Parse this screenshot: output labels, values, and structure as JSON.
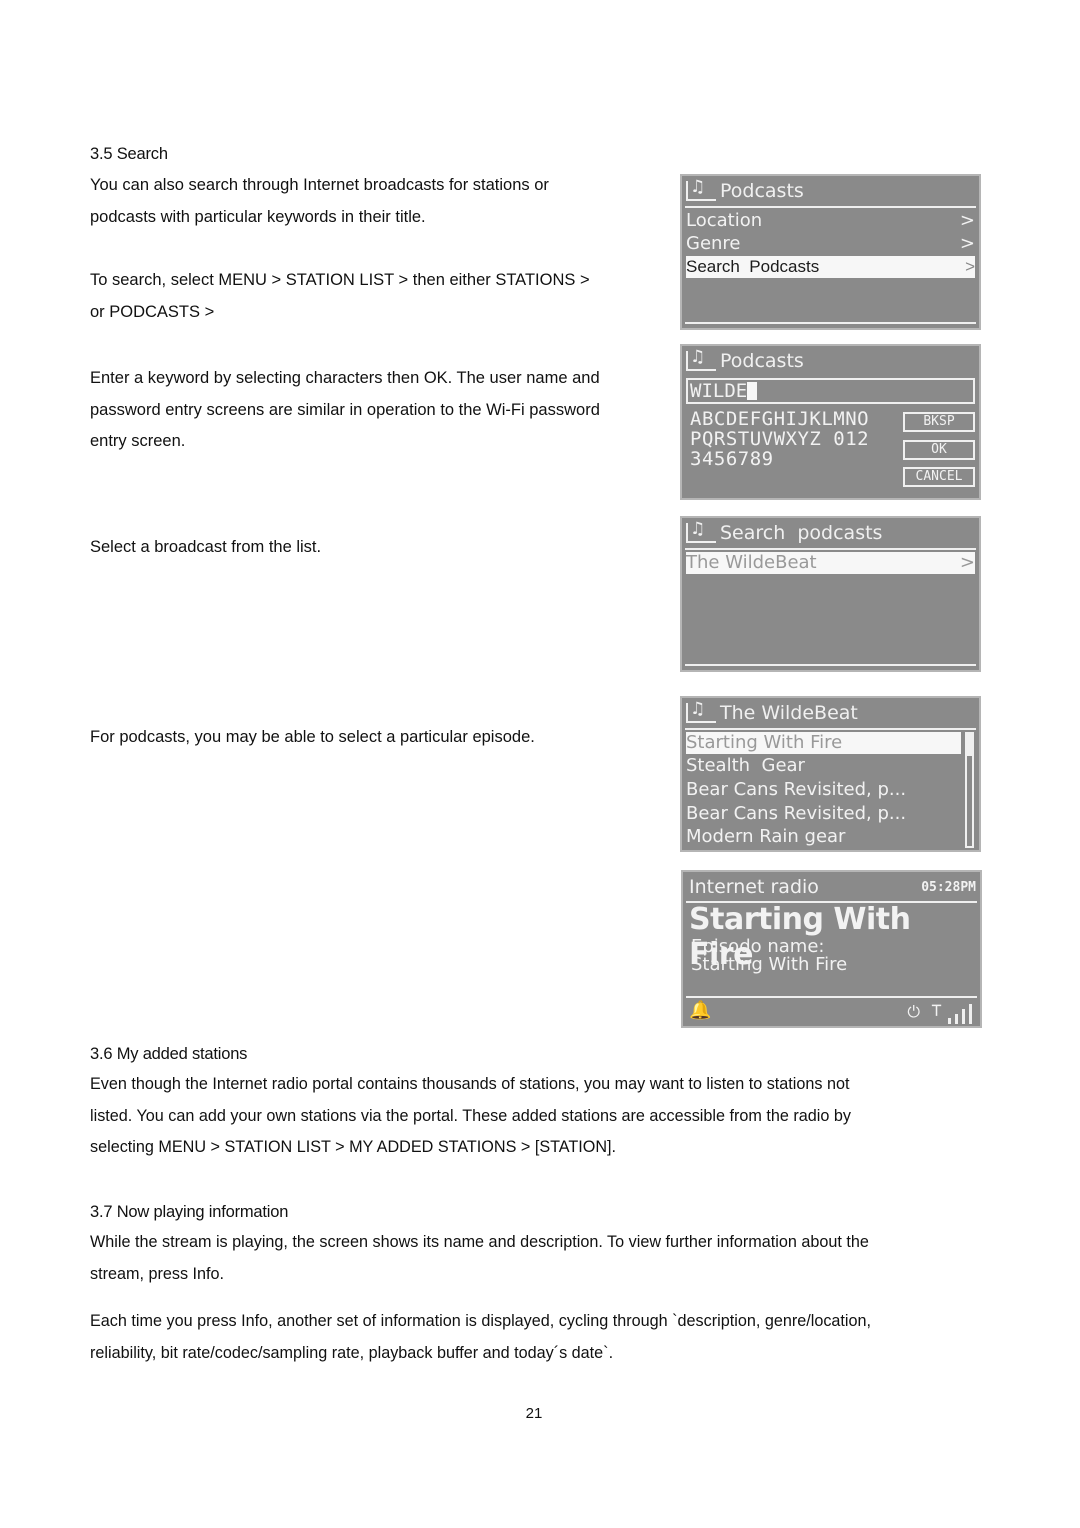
{
  "sections": {
    "search": {
      "heading": "3.5 Search",
      "para1_line1": "You can also search through Internet broadcasts for stations or",
      "para1_line2": "podcasts with particular keywords in their title.",
      "para2_line1": "To search, select MENU > STATION LIST > then either STATIONS >",
      "para2_line2": "or PODCASTS >",
      "para3_line1": "Enter a keyword by selecting characters then OK. The user name and",
      "para3_line2": "password entry screens are similar in operation to the Wi-Fi password",
      "para3_line3": "entry screen.",
      "para4": "Select a broadcast from the list.",
      "para5": "For podcasts, you may be able to select a particular episode."
    },
    "added": {
      "heading": "3.6 My added stations",
      "line1": "Even though the Internet radio portal contains thousands of stations, you may want to listen to stations not",
      "line2": "listed. You can add your own stations via the portal. These added stations are accessible from the radio by",
      "line3": "selecting MENU > STATION LIST > MY ADDED STATIONS > [STATION]."
    },
    "nowplaying": {
      "heading": "3.7 Now playing information",
      "p1_line1": "While the stream is playing, the screen shows its name and description. To view further information about the",
      "p1_line2": "stream, press Info.",
      "p2_line1": "Each time you press Info, another set of information is displayed, cycling through `description, genre/location,",
      "p2_line2": "reliability, bit rate/codec/sampling rate, playback buffer and today´s date`."
    }
  },
  "screens": {
    "podcasts_menu": {
      "title": "Podcasts",
      "items": [
        {
          "label": "Location",
          "chevron": ">"
        },
        {
          "label": "Genre",
          "chevron": ">"
        },
        {
          "label": "Search  Podcasts",
          "chevron": ">",
          "selected": true
        }
      ]
    },
    "keyword_entry": {
      "title": "Podcasts",
      "entry_value": "WILDE",
      "keyboard_rows": [
        "ABCDEFGHIJKLMNO",
        "PQRSTUVWXYZ 012",
        "3456789"
      ],
      "buttons": {
        "backspace": "BKSP",
        "ok": "OK",
        "cancel": "CANCEL"
      }
    },
    "search_results": {
      "title": "Search  podcasts",
      "items": [
        {
          "label": "The WildeBeat",
          "chevron": ">",
          "selected": true
        }
      ]
    },
    "episodes": {
      "title": "The WildeBeat",
      "items": [
        {
          "label": "Starting With Fire",
          "selected": true
        },
        {
          "label": "Stealth  Gear"
        },
        {
          "label": "Bear Cans Revisited, p..."
        },
        {
          "label": "Bear Cans Revisited, p..."
        },
        {
          "label": "Modern Rain gear"
        }
      ],
      "scroll_fraction": 0.2
    },
    "now_playing": {
      "mode": "Internet radio",
      "time": "05:28PM",
      "track": "Starting With Fire",
      "info_label": "Episodo name:",
      "info_value": "Starting With Fire",
      "icons": [
        "alarm-1-icon",
        "power-plug-icon",
        "antenna-icon",
        "signal-strength-icon"
      ]
    }
  },
  "footer": {
    "page_number": "21"
  }
}
